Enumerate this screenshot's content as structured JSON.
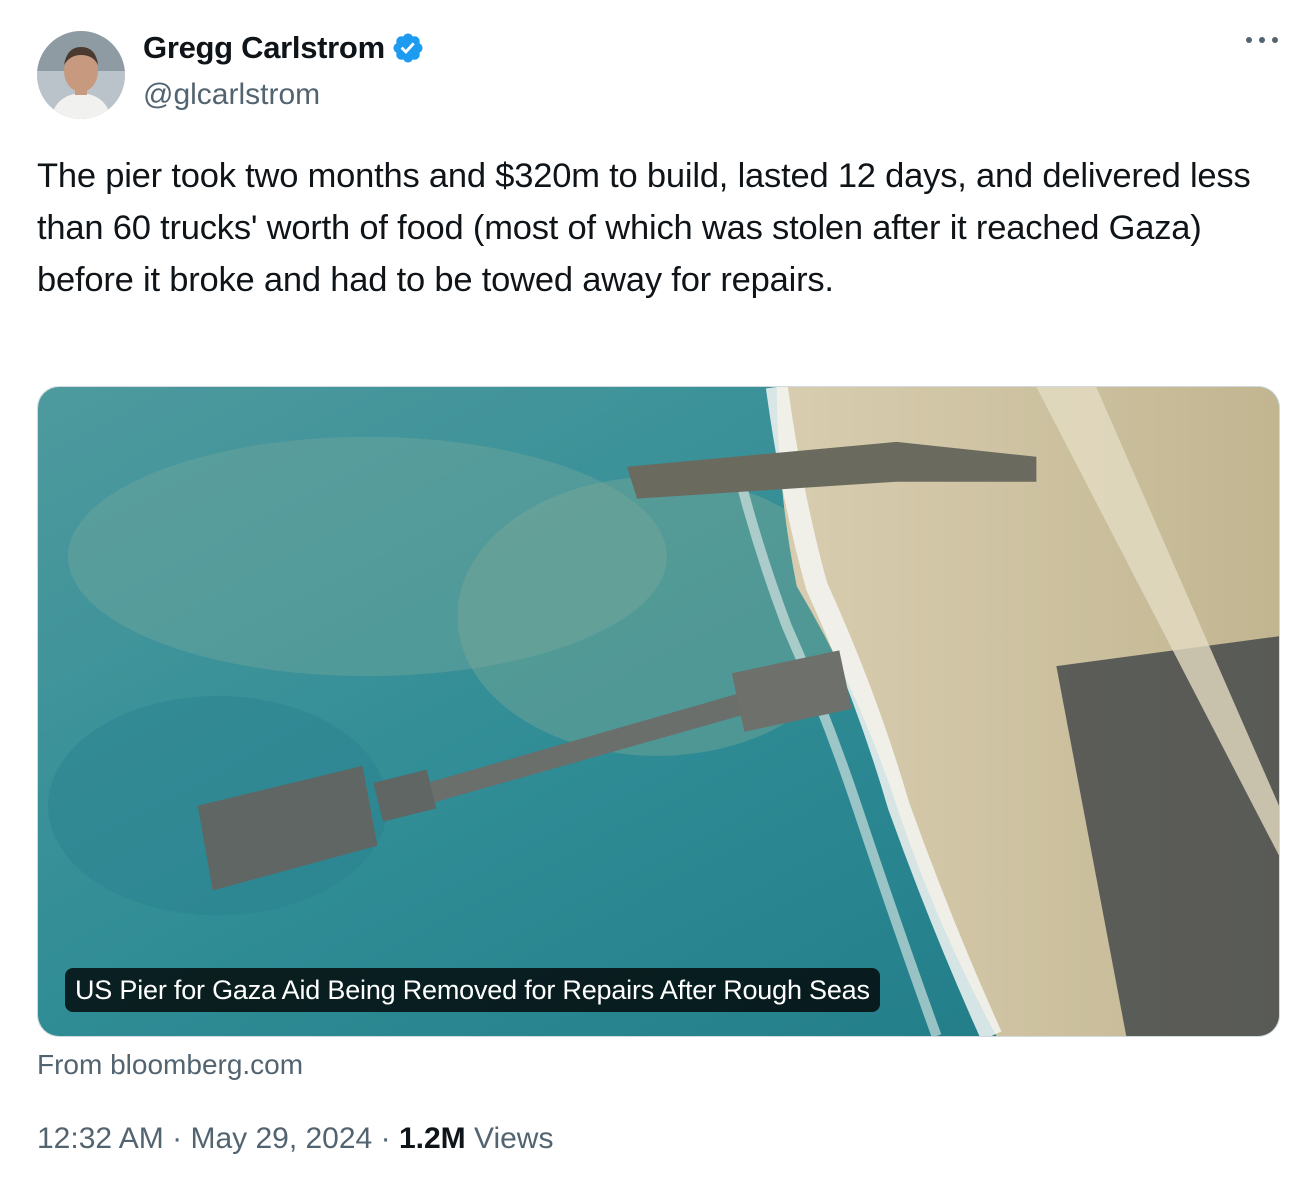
{
  "author": {
    "display_name": "Gregg Carlstrom",
    "handle": "@glcarlstrom",
    "verified_badge": "verified-check-icon",
    "verified_color": "#1d9bf0"
  },
  "tweet": {
    "text": "The pier took two months and $320m to build, lasted 12 days, and delivered less than 60 trucks' worth of food (most of which was stolen after it reached Gaza) before it broke and had to be towed away for repairs."
  },
  "card": {
    "caption": "US Pier for Gaza Aid Being Removed for Repairs After Rough Seas",
    "source": "From bloomberg.com"
  },
  "meta": {
    "time": "12:32 AM",
    "separator": "·",
    "date": "May 29, 2024",
    "views_count": "1.2M",
    "views_label": "Views"
  },
  "icons": {
    "more": "more-options-icon"
  }
}
